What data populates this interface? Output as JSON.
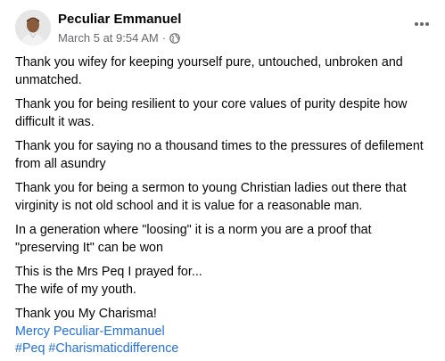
{
  "post": {
    "author": "Peculiar Emmanuel",
    "timestamp": "March 5 at 9:54 AM",
    "separator": "·",
    "paragraphs": [
      "Thank you wifey for keeping yourself pure, untouched, unbroken and unmatched.",
      "Thank you for being resilient to your core values of purity despite how difficult it was.",
      "Thank you for saying no a thousand times to the pressures of defilement from all asundry",
      "Thank you for being a sermon to young Christian ladies out there that virginity is not old school and it is value for a reasonable man.",
      "In a generation where \"loosing\" it is a norm you are a proof that \"preserving It\" can be won"
    ],
    "closing_line_1": "This is the Mrs Peq I prayed for...",
    "closing_line_2": "The wife of my youth.",
    "thanks_line": "Thank you My Charisma!",
    "tagged_person": "Mercy Peculiar-Emmanuel",
    "hashtags": "#Peq #Charismaticdifference"
  },
  "icons": {
    "more": "more-horizontal-icon",
    "privacy": "globe-icon"
  },
  "colors": {
    "link": "#216fdb",
    "meta": "#65676b",
    "text": "#050505"
  }
}
